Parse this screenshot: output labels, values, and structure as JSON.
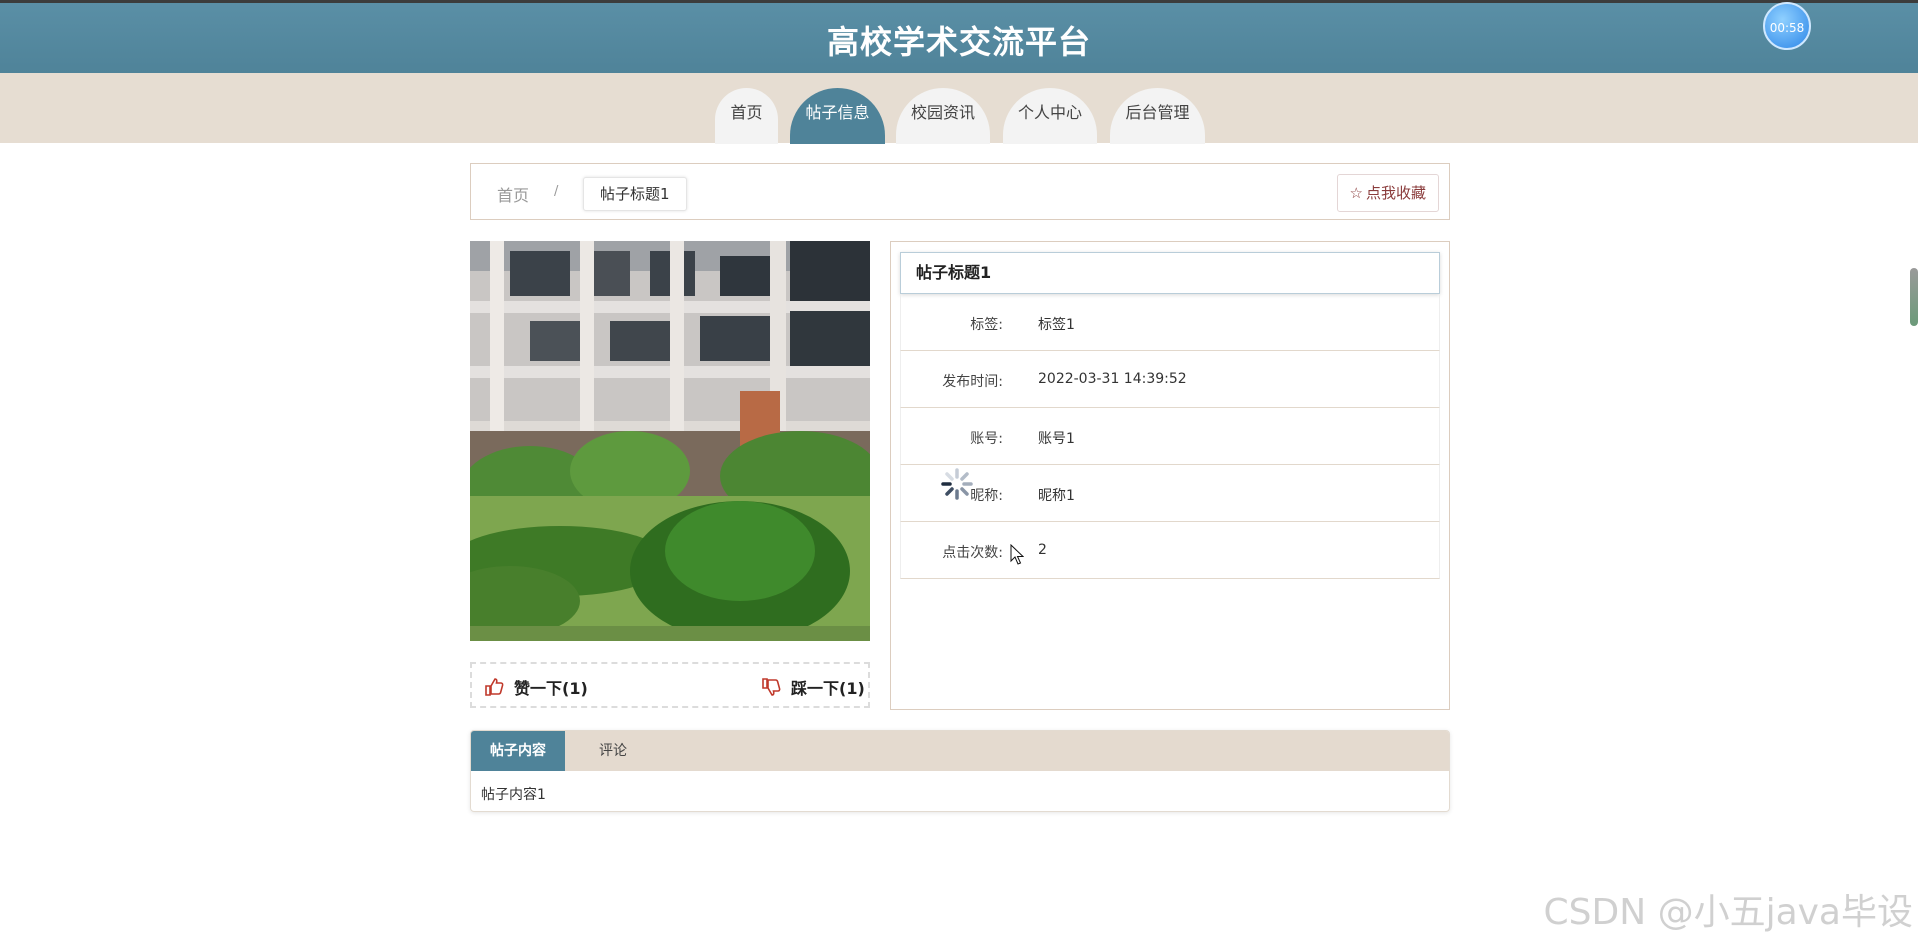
{
  "header": {
    "title": "高校学术交流平台",
    "timer": "00:58"
  },
  "nav": {
    "items": [
      {
        "label": "首页"
      },
      {
        "label": "帖子信息"
      },
      {
        "label": "校园资讯"
      },
      {
        "label": "个人中心"
      },
      {
        "label": "后台管理"
      }
    ],
    "active": "帖子信息"
  },
  "breadcrumb": {
    "home": "首页",
    "separator": "/",
    "current": "帖子标题1"
  },
  "favorite_button": {
    "label": "点我收藏",
    "icon": "star-outline-icon"
  },
  "post": {
    "title": "帖子标题1",
    "fields": [
      {
        "label": "标签:",
        "value": "标签1"
      },
      {
        "label": "发布时间:",
        "value": "2022-03-31 14:39:52"
      },
      {
        "label": "账号:",
        "value": "账号1"
      },
      {
        "label": "昵称:",
        "value": "昵称1"
      },
      {
        "label": "点击次数:",
        "value": "2"
      }
    ]
  },
  "votes": {
    "like": {
      "label": "赞一下(1)",
      "icon": "thumbs-up-icon"
    },
    "dislike": {
      "label": "踩一下(1)",
      "icon": "thumbs-down-icon"
    }
  },
  "content_tabs": {
    "tabs": [
      {
        "label": "帖子内容"
      },
      {
        "label": "评论"
      }
    ],
    "active_content": "帖子内容1"
  },
  "watermark": "CSDN @小五java毕设",
  "colors": {
    "primary": "#4f8399",
    "nav_band": "#e6ddd2",
    "accent_red": "#c0392b"
  }
}
